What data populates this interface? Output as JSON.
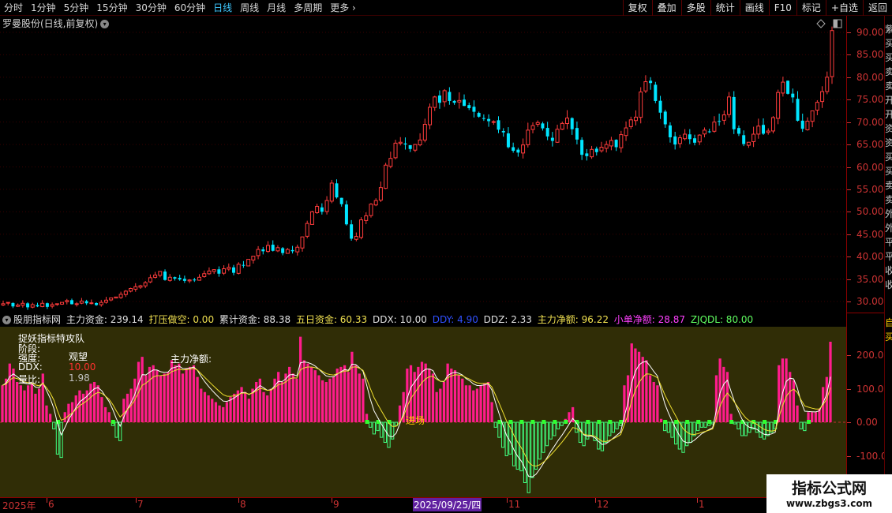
{
  "toolbar": {
    "periods": [
      "分时",
      "1分钟",
      "5分钟",
      "15分钟",
      "30分钟",
      "60分钟",
      "日线",
      "周线",
      "月线",
      "多周期",
      "更多"
    ],
    "active_period": "日线",
    "tools": [
      "复权",
      "叠加",
      "多股",
      "统计",
      "画线",
      "F10",
      "标记",
      "+自选",
      "返回"
    ]
  },
  "main": {
    "title": "罗曼股份(日线,前复权)",
    "collapse_icon": "chevron-down-icon",
    "corner_icons": [
      "diamond-icon",
      "window-icon"
    ],
    "y_labels": [
      "90.00",
      "85.00",
      "80.00",
      "75.00",
      "70.00",
      "65.00",
      "60.00",
      "55.00",
      "50.00",
      "45.00",
      "40.00",
      "35.00",
      "30.00"
    ],
    "right_strip_chars": [
      "紫",
      "买",
      "买",
      "卖",
      "卖",
      "开",
      "开",
      "资",
      "资",
      "买",
      "买",
      "卖",
      "卖",
      "外",
      "外",
      "平",
      "平",
      "收",
      "收"
    ]
  },
  "indicator": {
    "name": "股朋指标网",
    "fields": [
      {
        "label": "主力资金:",
        "value": "239.14",
        "color": "#e0e0e0"
      },
      {
        "label": "打压做空:",
        "value": "0.00",
        "color": "#f0e050"
      },
      {
        "label": "累计资金:",
        "value": "88.38",
        "color": "#e0e0e0"
      },
      {
        "label": "五日资金:",
        "value": "60.33",
        "color": "#f0e050"
      },
      {
        "label": "DDX:",
        "value": "10.00",
        "color": "#e0e0e0"
      },
      {
        "label": "DDY:",
        "value": "4.90",
        "color": "#3050ff"
      },
      {
        "label": "DDZ:",
        "value": "2.33",
        "color": "#e0e0e0"
      },
      {
        "label": "主力净额:",
        "value": "96.22",
        "color": "#f0e050"
      },
      {
        "label": "小单净额:",
        "value": "28.87",
        "color": "#ff40ff"
      },
      {
        "label": "ZJQDL:",
        "value": "80.00",
        "color": "#60ff60"
      }
    ],
    "panel_title": "捉妖指标特攻队",
    "stage_label": "阶段:",
    "strength_label": "强度:",
    "strength_value": "观望",
    "ddx_label": "DDX:",
    "ddx_value": "10.00",
    "ratio_label": "量比:",
    "ratio_value": "1.98",
    "net_label": "主力净额:",
    "entry_label": "进场",
    "y_labels": [
      "200.0",
      "100.0",
      "0.00",
      "-100.0"
    ],
    "right_strip_chars": [
      "自",
      "买"
    ]
  },
  "date_axis": {
    "labels": [
      "2025年",
      "6",
      "7",
      "8",
      "9",
      "11",
      "12",
      "1"
    ],
    "highlight": "2025/09/25/四"
  },
  "watermark": {
    "title": "指标公式网",
    "url": "www.zbgs3.com"
  },
  "chart_data": [
    {
      "type": "candlestick",
      "title": "罗曼股份(日线,前复权)",
      "ylim": [
        25,
        92
      ],
      "y_ticks": [
        30,
        35,
        40,
        45,
        50,
        55,
        60,
        65,
        70,
        75,
        80,
        85,
        90
      ],
      "close": [
        29.5,
        29.8,
        28.9,
        29.2,
        29.6,
        28.7,
        29.3,
        28.9,
        29.6,
        28.8,
        29.3,
        29.5,
        29.8,
        30.2,
        29.4,
        29.5,
        30.1,
        29.6,
        29.7,
        29.2,
        29.8,
        30.3,
        30.8,
        31.0,
        31.6,
        32.3,
        32.9,
        33.3,
        33.5,
        34.2,
        35.3,
        35.9,
        36.7,
        34.8,
        35.4,
        35.1,
        34.9,
        34.6,
        34.8,
        34.7,
        35.4,
        36.2,
        36.8,
        37.1,
        36.2,
        37.3,
        37.6,
        36.4,
        38.3,
        38.0,
        39.4,
        40.1,
        41.6,
        41.2,
        42.5,
        41.3,
        42.0,
        40.8,
        41.6,
        41.2,
        42.1,
        44.4,
        47.4,
        50.0,
        51.2,
        50.0,
        52.5,
        56.4,
        53.2,
        51.7,
        47.2,
        44.0,
        44.5,
        48.2,
        49.1,
        51.7,
        52.5,
        55.4,
        60.4,
        61.9,
        65.3,
        65.5,
        65.0,
        64.0,
        65.0,
        66.0,
        69.5,
        73.3,
        75.6,
        74.3,
        77.0,
        74.7,
        74.3,
        74.8,
        73.6,
        73.1,
        72.3,
        71.2,
        70.7,
        70.2,
        70.1,
        68.3,
        67.7,
        64.4,
        63.6,
        63.2,
        64.9,
        68.2,
        69.2,
        69.9,
        68.6,
        66.8,
        65.8,
        68.4,
        69.7,
        70.9,
        68.4,
        66.1,
        62.7,
        62.4,
        63.9,
        63.3,
        64.4,
        65.0,
        65.9,
        64.4,
        67.2,
        68.7,
        70.5,
        71.1,
        76.7,
        79.0,
        78.7,
        74.7,
        72.1,
        69.5,
        66.6,
        65.0,
        66.5,
        67.3,
        66.2,
        65.4,
        67.1,
        68.2,
        67.8,
        70.0,
        70.1,
        71.6,
        75.6,
        68.4,
        67.4,
        65.1,
        65.5,
        67.3,
        69.1,
        67.4,
        68.0,
        71.0,
        76.6,
        78.9,
        76.3,
        75.5,
        70.3,
        68.5,
        70.2,
        72.5,
        74.4,
        76.8,
        80.0,
        90.4
      ]
    },
    {
      "type": "bar",
      "title": "股朋指标网",
      "ylim": [
        -150,
        260
      ],
      "y_ticks": [
        200,
        100,
        0,
        -100
      ],
      "values": [
        110,
        130,
        175,
        160,
        120,
        110,
        95,
        110,
        115,
        85,
        100,
        145,
        50,
        25,
        -20,
        -95,
        -105,
        30,
        55,
        60,
        80,
        95,
        85,
        95,
        115,
        120,
        110,
        75,
        45,
        30,
        -10,
        -45,
        -55,
        70,
        85,
        100,
        130,
        180,
        195,
        140,
        165,
        170,
        155,
        140,
        145,
        150,
        185,
        170,
        175,
        145,
        160,
        165,
        170,
        135,
        100,
        90,
        80,
        70,
        60,
        50,
        45,
        60,
        75,
        85,
        95,
        105,
        90,
        70,
        100,
        120,
        130,
        90,
        80,
        100,
        130,
        150,
        120,
        145,
        165,
        145,
        130,
        255,
        185,
        175,
        165,
        155,
        140,
        125,
        120,
        130,
        135,
        160,
        165,
        170,
        150,
        210,
        170,
        145,
        130,
        25,
        -15,
        -35,
        -25,
        -45,
        -60,
        -75,
        -50,
        -10,
        50,
        90,
        160,
        170,
        150,
        165,
        180,
        175,
        160,
        145,
        90,
        100,
        120,
        175,
        160,
        155,
        140,
        130,
        110,
        110,
        95,
        100,
        110,
        115,
        120,
        60,
        -15,
        -45,
        -75,
        -100,
        -95,
        -130,
        -140,
        -145,
        -180,
        -210,
        -165,
        -140,
        -110,
        -90,
        -70,
        -50,
        -40,
        -20,
        -10,
        10,
        30,
        45,
        -30,
        -60,
        -70,
        -50,
        -40,
        -55,
        -80,
        -85,
        -60,
        -40,
        -30,
        -20,
        -10,
        110,
        140,
        235,
        220,
        210,
        195,
        185,
        140,
        120,
        110,
        10,
        -25,
        -30,
        -45,
        -65,
        -80,
        -90,
        -70,
        -60,
        -40,
        -25,
        -15,
        -15,
        -10,
        -5,
        140,
        190,
        165,
        150,
        25,
        -5,
        -20,
        -40,
        -40,
        -30,
        -20,
        -30,
        -45,
        -50,
        -40,
        -30,
        -20,
        170,
        190,
        190,
        150,
        125,
        50,
        -20,
        -25,
        30,
        30,
        30,
        40,
        105,
        135,
        240
      ]
    }
  ]
}
